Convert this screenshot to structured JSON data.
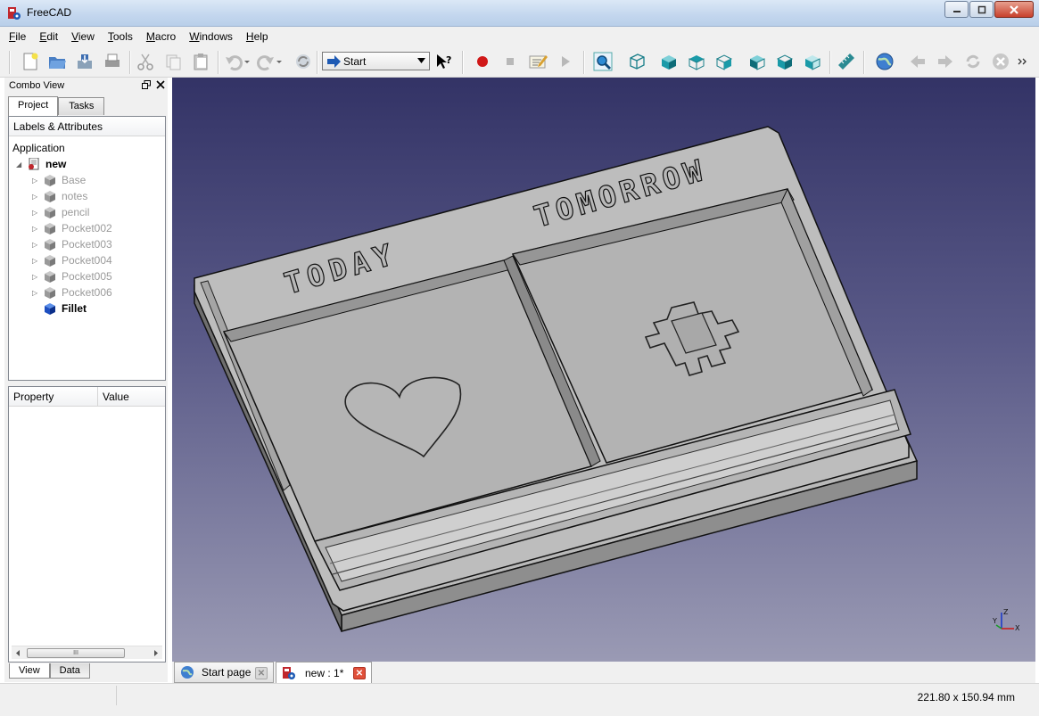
{
  "window": {
    "title": "FreeCAD"
  },
  "menu": [
    {
      "accel": "F",
      "rest": "ile"
    },
    {
      "accel": "E",
      "rest": "dit"
    },
    {
      "accel": "V",
      "rest": "iew"
    },
    {
      "accel": "T",
      "rest": "ools"
    },
    {
      "accel": "M",
      "rest": "acro"
    },
    {
      "accel": "W",
      "rest": "indows"
    },
    {
      "accel": "H",
      "rest": "elp"
    }
  ],
  "toolbar": {
    "workbench": "Start"
  },
  "combo_view": {
    "title": "Combo View",
    "tabs": [
      "Project",
      "Tasks"
    ],
    "active_tab": "Project",
    "tree_header": "Labels & Attributes",
    "tree": {
      "root": "Application",
      "document": "new",
      "items": [
        {
          "label": "Base",
          "visible": false
        },
        {
          "label": "notes",
          "visible": false
        },
        {
          "label": "pencil",
          "visible": false
        },
        {
          "label": "Pocket002",
          "visible": false
        },
        {
          "label": "Pocket003",
          "visible": false
        },
        {
          "label": "Pocket004",
          "visible": false
        },
        {
          "label": "Pocket005",
          "visible": false
        },
        {
          "label": "Pocket006",
          "visible": false
        },
        {
          "label": "Fillet",
          "visible": true
        }
      ]
    },
    "property_headers": [
      "Property",
      "Value"
    ],
    "scroll_thumb": "III",
    "bottom_tabs": [
      "View",
      "Data"
    ]
  },
  "model": {
    "label_left": "TODAY",
    "label_right": "TOMORROW"
  },
  "axis": {
    "x": "X",
    "y": "Y",
    "z": "Z"
  },
  "doc_tabs": [
    {
      "label": "Start page",
      "active": false
    },
    {
      "label": "new : 1*",
      "active": true
    }
  ],
  "status": {
    "dimensions": "221.80 x 150.94 mm"
  },
  "colors": {
    "accent_blue": "#1e5ab4",
    "record_red": "#d01818",
    "cube_teal": "#1a9aa8"
  }
}
